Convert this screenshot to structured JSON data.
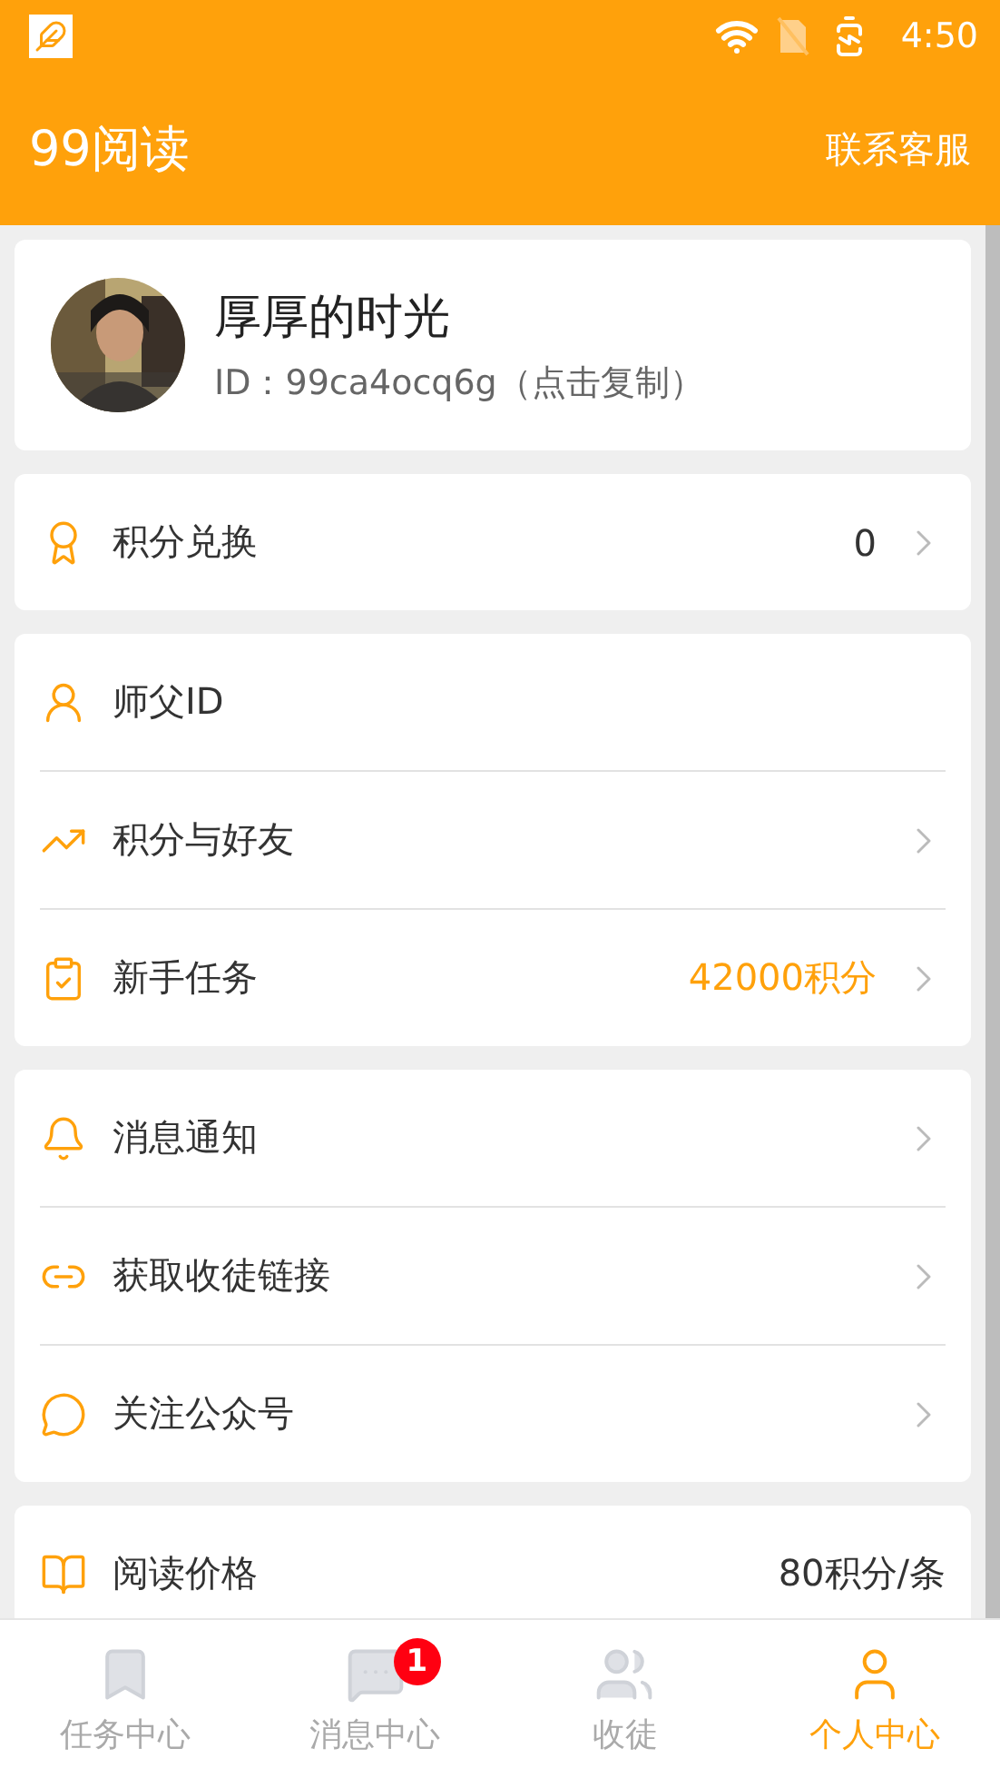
{
  "status_bar": {
    "time": "4:50"
  },
  "header": {
    "title": "99阅读",
    "action": "联系客服"
  },
  "profile": {
    "name": "厚厚的时光",
    "id_line": "ID：99ca4ocq6g（点击复制）"
  },
  "groups": [
    {
      "rows": [
        {
          "label": "积分兑换",
          "value": "0",
          "accent": false,
          "chevron": true
        }
      ]
    },
    {
      "rows": [
        {
          "label": "师父ID",
          "chevron": false
        },
        {
          "label": "积分与好友",
          "chevron": true
        },
        {
          "label": "新手任务",
          "value": "42000积分",
          "accent": true,
          "chevron": true
        }
      ]
    },
    {
      "rows": [
        {
          "label": "消息通知",
          "chevron": true
        },
        {
          "label": "获取收徒链接",
          "chevron": true
        },
        {
          "label": "关注公众号",
          "chevron": true
        }
      ]
    },
    {
      "rows": [
        {
          "label": "阅读价格",
          "value": "80积分/条",
          "accent": false,
          "chevron": false
        }
      ]
    }
  ],
  "bottom_nav": [
    {
      "label": "任务中心",
      "selected": false
    },
    {
      "label": "消息中心",
      "selected": false,
      "badge": "1"
    },
    {
      "label": "收徒",
      "selected": false
    },
    {
      "label": "个人中心",
      "selected": true
    }
  ]
}
